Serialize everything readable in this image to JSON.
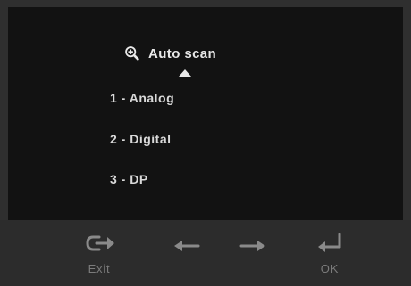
{
  "menu": {
    "title": "Auto scan",
    "items": [
      "1 - Analog",
      "2 - Digital",
      "3 - DP"
    ]
  },
  "controls": {
    "exit_label": "Exit",
    "ok_label": "OK"
  },
  "icons": {
    "title": "zoom-in-icon",
    "selected_indicator": "triangle-up-icon",
    "exit": "exit-icon",
    "left": "left-arrow-icon",
    "right": "right-arrow-icon",
    "ok": "enter-icon"
  },
  "colors": {
    "panel_background": "#121212",
    "screen_background": "#2f2f2f",
    "menu_text": "#d9d9d9",
    "button_icon": "#8a8a8a"
  }
}
